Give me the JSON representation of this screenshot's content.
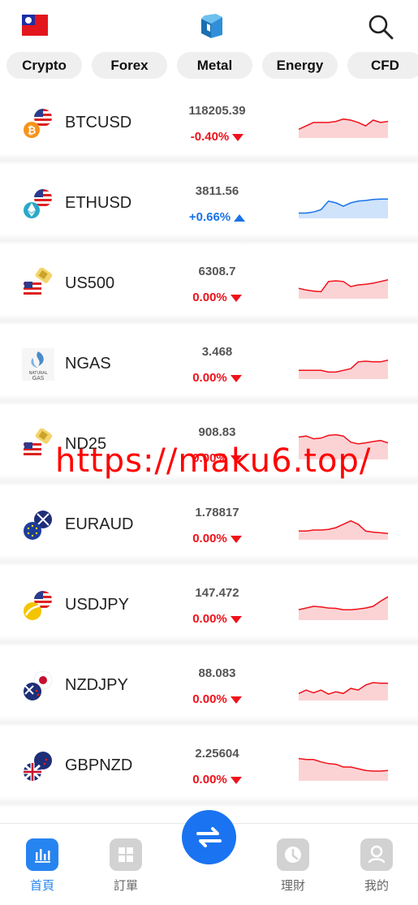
{
  "header": {
    "flag_icon": "taiwan-flag-icon",
    "logo_icon": "app-logo-icon",
    "search_icon": "search-icon"
  },
  "tabs": [
    {
      "label": "Crypto"
    },
    {
      "label": "Forex"
    },
    {
      "label": "Metal"
    },
    {
      "label": "Energy"
    },
    {
      "label": "CFD"
    }
  ],
  "quotes": [
    {
      "symbol": "BTCUSD",
      "price": "118205.39",
      "change": "-0.40%",
      "direction": "down",
      "icon": "bitcoin-usd-icon",
      "spark": [
        0.35,
        0.45,
        0.55,
        0.55,
        0.55,
        0.58,
        0.65,
        0.62,
        0.55,
        0.45,
        0.62,
        0.55,
        0.58
      ]
    },
    {
      "symbol": "ETHUSD",
      "price": "3811.56",
      "change": "+0.66%",
      "direction": "up",
      "icon": "ethereum-usd-icon",
      "spark": [
        0.25,
        0.25,
        0.28,
        0.35,
        0.6,
        0.55,
        0.45,
        0.55,
        0.6,
        0.62,
        0.65,
        0.66,
        0.66
      ]
    },
    {
      "symbol": "US500",
      "price": "6308.7",
      "change": "0.00%",
      "direction": "down",
      "icon": "us500-index-icon",
      "spark": [
        0.4,
        0.35,
        0.32,
        0.3,
        0.6,
        0.62,
        0.6,
        0.45,
        0.5,
        0.52,
        0.55,
        0.6,
        0.65
      ]
    },
    {
      "symbol": "NGAS",
      "price": "3.468",
      "change": "0.00%",
      "direction": "down",
      "icon": "natural-gas-icon",
      "spark": [
        0.35,
        0.35,
        0.35,
        0.35,
        0.3,
        0.3,
        0.35,
        0.4,
        0.6,
        0.62,
        0.6,
        0.6,
        0.65
      ]
    },
    {
      "symbol": "ND25",
      "price": "908.83",
      "change": "0.00%",
      "direction": "down",
      "icon": "nasdaq-index-icon",
      "spark": [
        0.75,
        0.78,
        0.7,
        0.72,
        0.8,
        0.82,
        0.78,
        0.6,
        0.55,
        0.58,
        0.62,
        0.65,
        0.58
      ]
    },
    {
      "symbol": "EURAUD",
      "price": "1.78817",
      "change": "0.00%",
      "direction": "down",
      "icon": "euro-aud-icon",
      "spark": [
        0.35,
        0.35,
        0.38,
        0.38,
        0.4,
        0.45,
        0.55,
        0.65,
        0.55,
        0.35,
        0.32,
        0.3,
        0.28
      ]
    },
    {
      "symbol": "USDJPY",
      "price": "147.472",
      "change": "0.00%",
      "direction": "down",
      "icon": "usd-jpy-icon",
      "spark": [
        0.4,
        0.45,
        0.5,
        0.48,
        0.45,
        0.44,
        0.4,
        0.4,
        0.42,
        0.45,
        0.5,
        0.65,
        0.78
      ]
    },
    {
      "symbol": "NZDJPY",
      "price": "88.083",
      "change": "0.00%",
      "direction": "down",
      "icon": "nzd-jpy-icon",
      "spark": [
        0.3,
        0.4,
        0.32,
        0.4,
        0.28,
        0.35,
        0.3,
        0.45,
        0.4,
        0.55,
        0.62,
        0.6,
        0.6
      ]
    },
    {
      "symbol": "GBPNZD",
      "price": "2.25604",
      "change": "0.00%",
      "direction": "down",
      "icon": "gbp-nzd-icon",
      "spark": [
        0.75,
        0.72,
        0.72,
        0.65,
        0.6,
        0.58,
        0.5,
        0.5,
        0.45,
        0.4,
        0.38,
        0.38,
        0.4
      ]
    }
  ],
  "watermark": "https://maku6.top/",
  "bottom_nav": [
    {
      "label": "首頁",
      "icon": "chart-bars-icon",
      "active": true
    },
    {
      "label": "訂單",
      "icon": "grid-icon",
      "active": false
    },
    {
      "label": "理財",
      "icon": "clock-icon",
      "active": false
    },
    {
      "label": "我的",
      "icon": "user-icon",
      "active": false
    }
  ],
  "fab_icon": "exchange-arrows-icon",
  "colors": {
    "up": "#1a73e8",
    "down": "#f0111a",
    "accent": "#2684f0"
  }
}
